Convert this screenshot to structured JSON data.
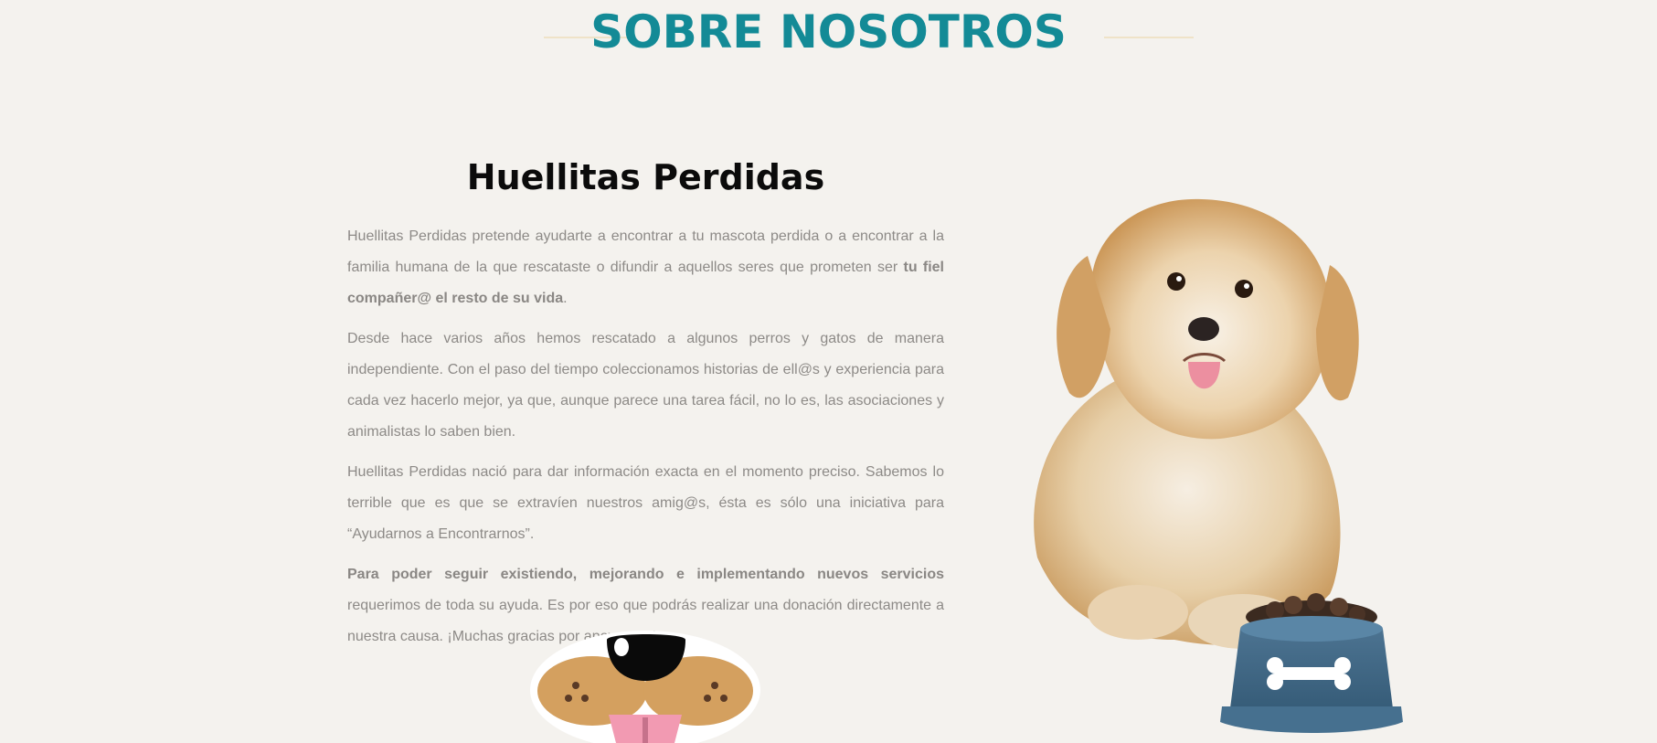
{
  "section": {
    "title": "SOBRE NOSOTROS"
  },
  "about": {
    "heading": "Huellitas Perdidas",
    "p1_text": "Huellitas Perdidas pretende ayudarte a encontrar a tu mascota perdida o a encontrar a la familia humana de la que rescataste o difundir a aquellos seres que prometen ser ",
    "p1_bold": "tu fiel compañer@ el resto de su vida",
    "p1_end": ".",
    "p2": "Desde hace varios años hemos rescatado a algunos perros y gatos de manera independiente. Con el paso del tiempo coleccionamos historias de ell@s y experiencia para cada vez hacerlo mejor, ya que, aunque parece una tarea fácil, no lo es, las asociaciones y animalistas lo saben bien.",
    "p3": "Huellitas Perdidas nació para dar información exacta en el momento preciso. Sabemos lo terrible que es que se extravíen nuestros amig@s, ésta es sólo una iniciativa para “Ayudarnos a Encontrarnos”.",
    "p4_bold": "Para poder seguir existiendo, mejorando e implementando nuevos servicios",
    "p4_text": " requerimos de toda su ayuda. Es por eso que podrás realizar una donación directamente a nuestra causa. ¡Muchas gracias por apoyarnos!"
  },
  "colors": {
    "background": "#f4f2ee",
    "title": "#138a96",
    "body_text": "#8d8a87",
    "heading": "#0b0b0b"
  },
  "images": {
    "dog_photo": "puppy-illustration",
    "food_bowl": "dog-food-bowl-icon",
    "snout": "dog-snout-icon"
  }
}
